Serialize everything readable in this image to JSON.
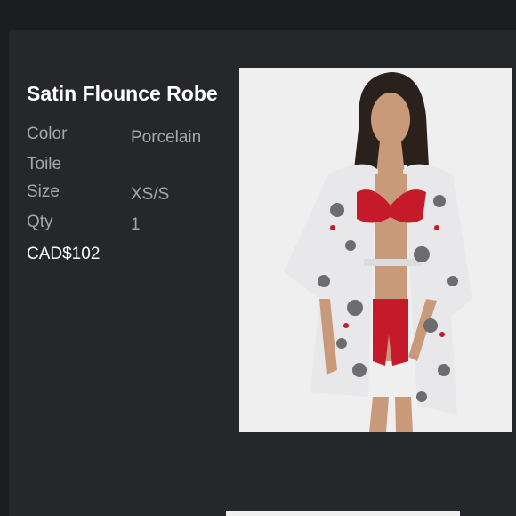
{
  "product": {
    "title": "Satin Flounce Robe",
    "attributes": [
      {
        "label": "Color",
        "value": "Porcelain"
      },
      {
        "label": "Toile",
        "value": ""
      },
      {
        "label": "Size",
        "value": "XS/S"
      },
      {
        "label": "Qty",
        "value": "1"
      }
    ],
    "price": "CAD$102"
  },
  "colors": {
    "page_background": "#1c1d20",
    "card_background": "#26272a",
    "title_text": "#ffffff",
    "label_text": "#a6a7aa",
    "image_background": "#efefef",
    "accent_red": "#c41a2a"
  }
}
